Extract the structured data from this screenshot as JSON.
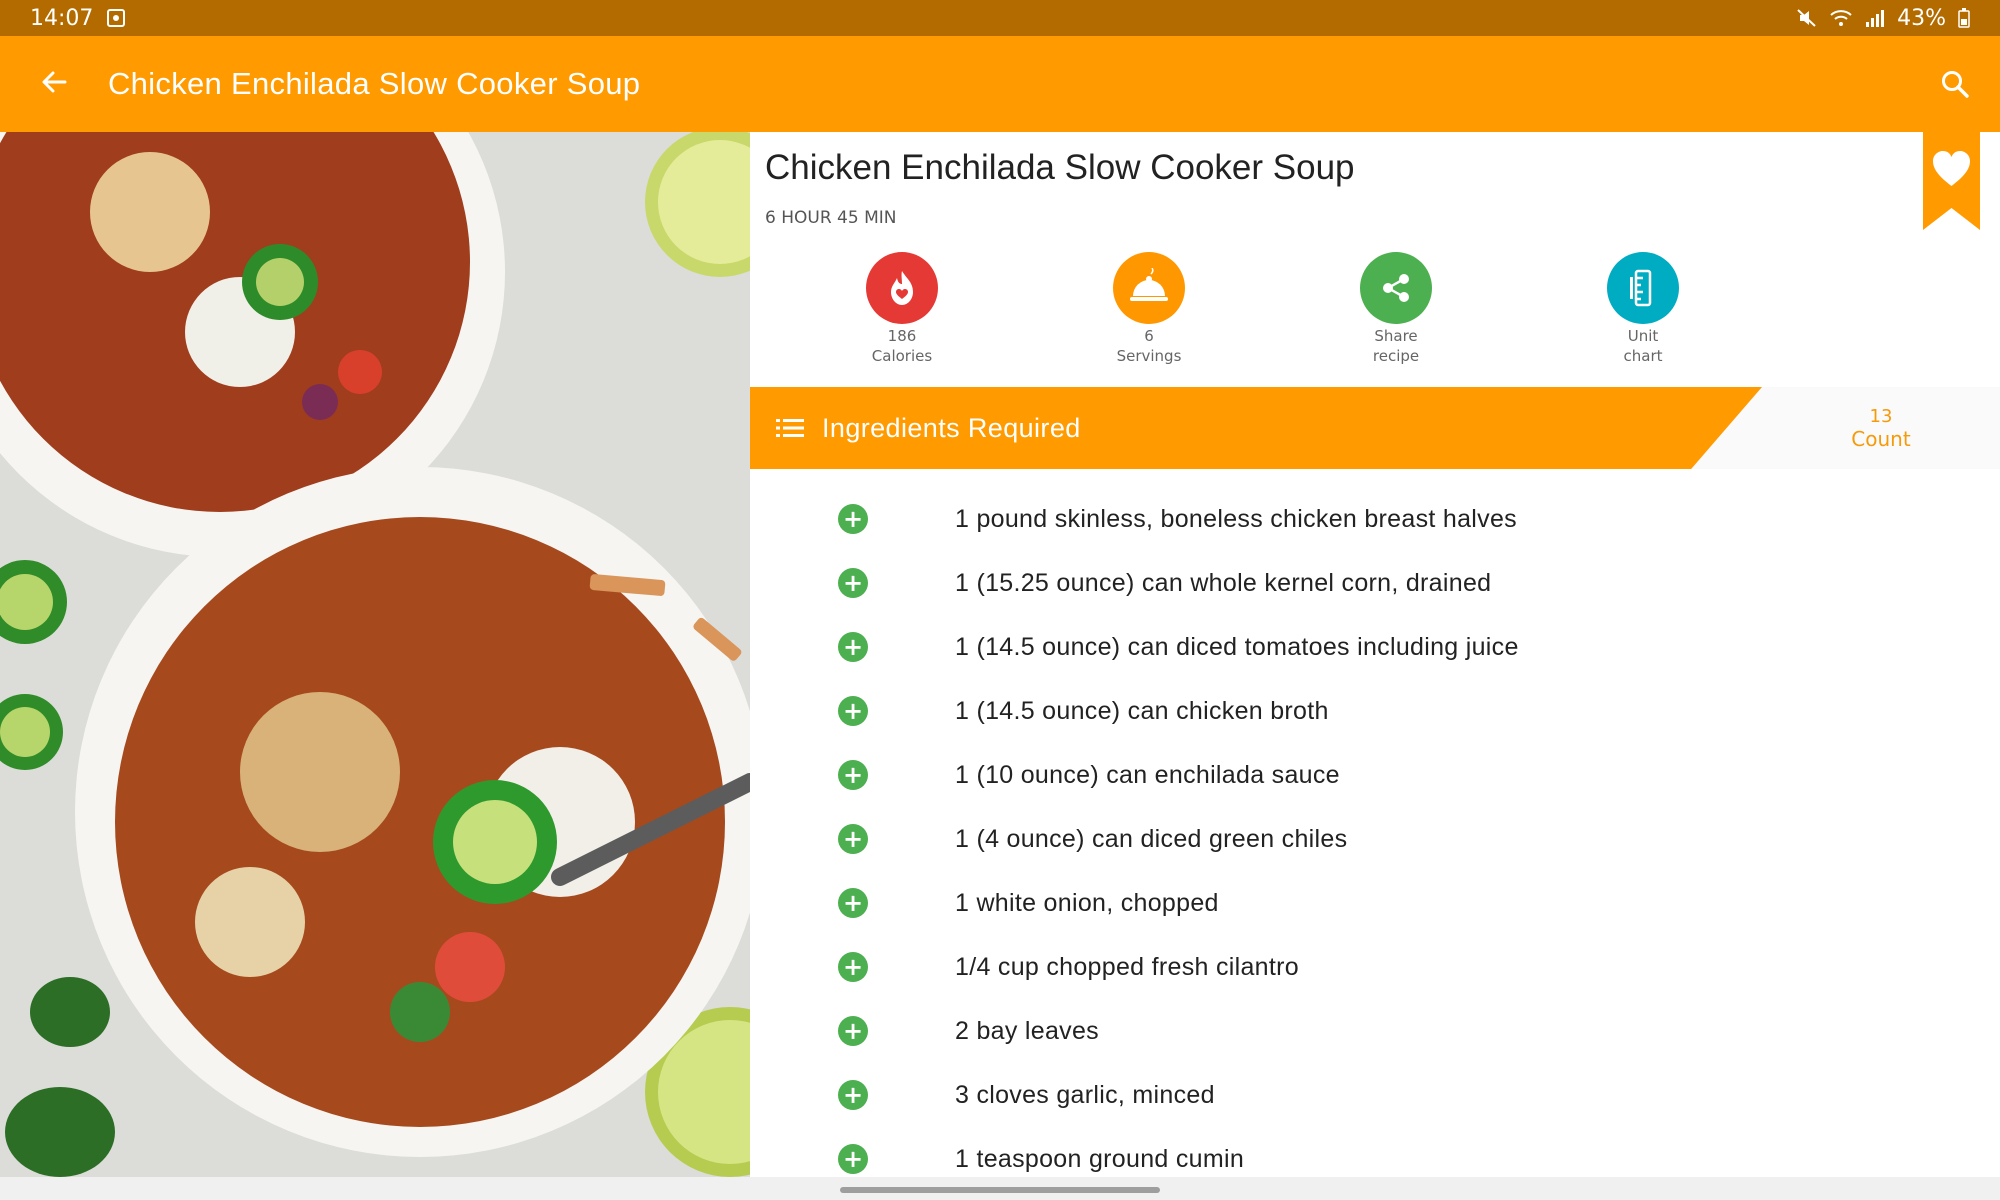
{
  "status_bar": {
    "time": "14:07",
    "battery": "43%",
    "icons": [
      "screenshot-notification-icon",
      "mute-icon",
      "wifi-icon",
      "signal-icon",
      "battery-icon"
    ]
  },
  "app_bar": {
    "title": "Chicken Enchilada Slow Cooker Soup",
    "back_icon": "arrow-back-icon",
    "search_icon": "search-icon"
  },
  "recipe": {
    "title": "Chicken Enchilada Slow Cooker Soup",
    "time": "6 HOUR 45 MIN",
    "favorite_icon": "heart-bookmark-icon",
    "accent_color": "#ff9a00"
  },
  "actions": [
    {
      "value": "186",
      "label": "Calories",
      "icon": "calories-flame-icon",
      "color": "#e53935"
    },
    {
      "value": "6",
      "label": "Servings",
      "icon": "serving-dish-icon",
      "color": "#ff9800"
    },
    {
      "value": "Share",
      "label": "recipe",
      "icon": "share-icon",
      "color": "#4caf50"
    },
    {
      "value": "Unit",
      "label": "chart",
      "icon": "ruler-icon",
      "color": "#00acc1"
    }
  ],
  "ingredients_header": {
    "title": "Ingredients Required",
    "count": "13",
    "count_label": "Count"
  },
  "ingredients": [
    "1 pound skinless, boneless chicken breast halves",
    "1 (15.25 ounce) can whole kernel corn, drained",
    "1 (14.5 ounce) can diced tomatoes including juice",
    "1 (14.5 ounce) can chicken broth",
    "1 (10 ounce) can enchilada sauce",
    "1 (4 ounce) can diced green chiles",
    "1 white onion, chopped",
    "1/4 cup chopped fresh cilantro",
    "2 bay leaves",
    "3 cloves garlic, minced",
    "1 teaspoon ground cumin"
  ]
}
